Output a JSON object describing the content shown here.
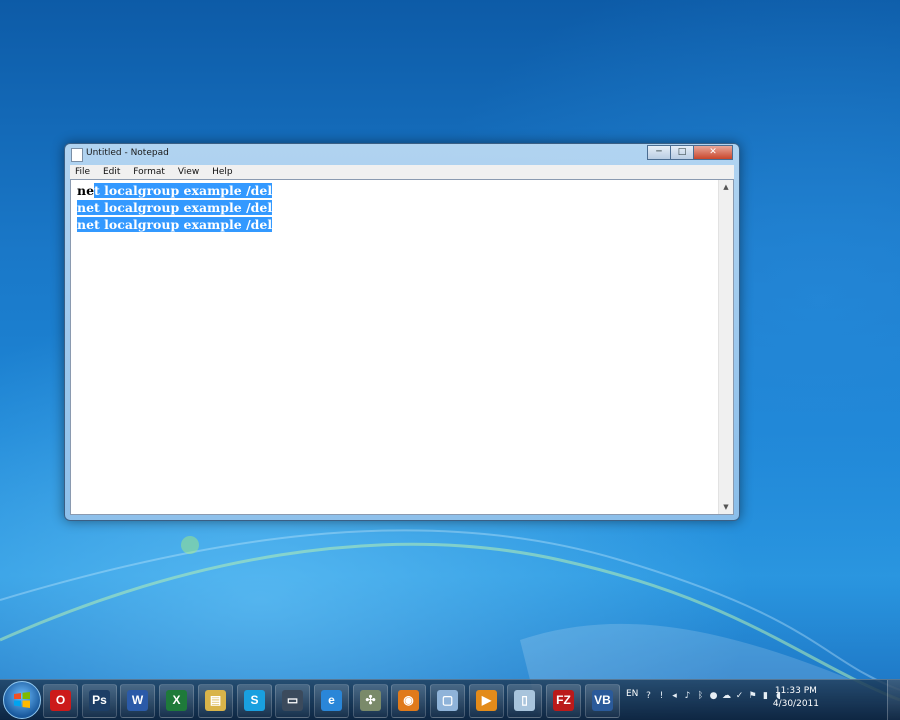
{
  "window": {
    "title": "Untitled - Notepad",
    "controls": {
      "minimize": "─",
      "maximize": "□",
      "close": "✕"
    }
  },
  "menu": {
    "items": [
      "File",
      "Edit",
      "Format",
      "View",
      "Help"
    ]
  },
  "editor": {
    "lines": [
      {
        "unselected": "ne",
        "selected": "t localgroup example /del"
      },
      {
        "unselected": "",
        "selected": "net localgroup example /del"
      },
      {
        "unselected": "",
        "selected": "net localgroup example /del"
      }
    ],
    "selection_color": "#3399ff"
  },
  "taskbar": {
    "apps": [
      {
        "name": "opera",
        "glyph": "O",
        "color": "#cc1a1a"
      },
      {
        "name": "photoshop",
        "glyph": "Ps",
        "color": "#1d3e66"
      },
      {
        "name": "word",
        "glyph": "W",
        "color": "#2b5aa8"
      },
      {
        "name": "excel",
        "glyph": "X",
        "color": "#1e7a3a"
      },
      {
        "name": "explorer",
        "glyph": "▤",
        "color": "#d9b44a"
      },
      {
        "name": "skype",
        "glyph": "S",
        "color": "#19a0e0"
      },
      {
        "name": "remote-desktop",
        "glyph": "▭",
        "color": "#3b4a5c"
      },
      {
        "name": "internet-explorer",
        "glyph": "e",
        "color": "#2a86d8"
      },
      {
        "name": "network-tool",
        "glyph": "✣",
        "color": "#7a8a6a"
      },
      {
        "name": "firefox",
        "glyph": "◉",
        "color": "#e07a1a"
      },
      {
        "name": "window-app",
        "glyph": "▢",
        "color": "#8fb3d9"
      },
      {
        "name": "media-player",
        "glyph": "▶",
        "color": "#e38b1a"
      },
      {
        "name": "notepad",
        "glyph": "▯",
        "color": "#a8c4dc"
      },
      {
        "name": "filezilla",
        "glyph": "FZ",
        "color": "#bb1a1a"
      },
      {
        "name": "virtual-machine",
        "glyph": "VB",
        "color": "#2a5a9a"
      }
    ],
    "tray": {
      "language": "EN",
      "time": "11:33 PM",
      "date": "4/30/2011"
    }
  }
}
